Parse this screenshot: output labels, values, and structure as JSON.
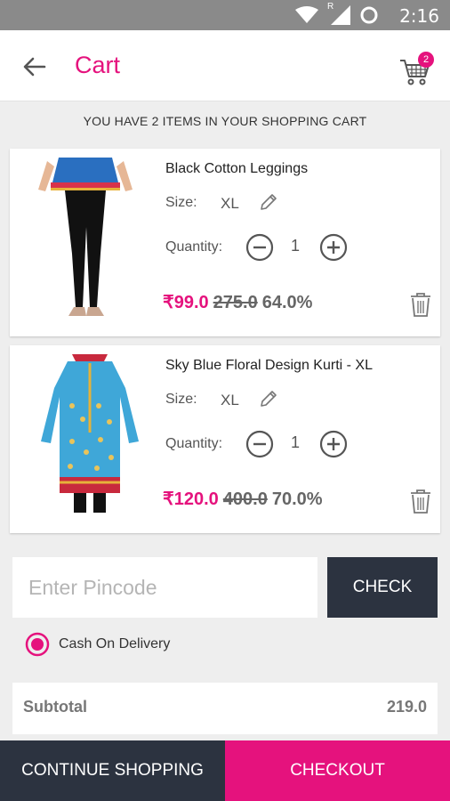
{
  "status_bar": {
    "time": "2:16",
    "roaming": "R"
  },
  "header": {
    "title": "Cart",
    "cart_count": "2"
  },
  "summary": "YOU HAVE 2 ITEMS IN YOUR SHOPPING CART",
  "labels": {
    "size": "Size:",
    "quantity": "Quantity:"
  },
  "items": [
    {
      "name": "Black Cotton Leggings",
      "size": "XL",
      "quantity": "1",
      "price": "₹99.0",
      "original_price": "275.0",
      "discount": "64.0%"
    },
    {
      "name": "Sky Blue Floral Design Kurti - XL",
      "size": "XL",
      "quantity": "1",
      "price": "₹120.0",
      "original_price": "400.0",
      "discount": "70.0%"
    }
  ],
  "pincode": {
    "placeholder": "Enter Pincode",
    "value": "",
    "button_label": "CHECK"
  },
  "payment": {
    "option_label": "Cash On Delivery",
    "selected": true
  },
  "subtotal": {
    "label": "Subtotal",
    "value": "219.0"
  },
  "footer": {
    "continue_label": "CONTINUE SHOPPING",
    "checkout_label": "CHECKOUT"
  },
  "colors": {
    "accent": "#e5127d",
    "dark": "#2c3340",
    "background": "#eeeeee",
    "status_bar": "#8a8a8a"
  }
}
